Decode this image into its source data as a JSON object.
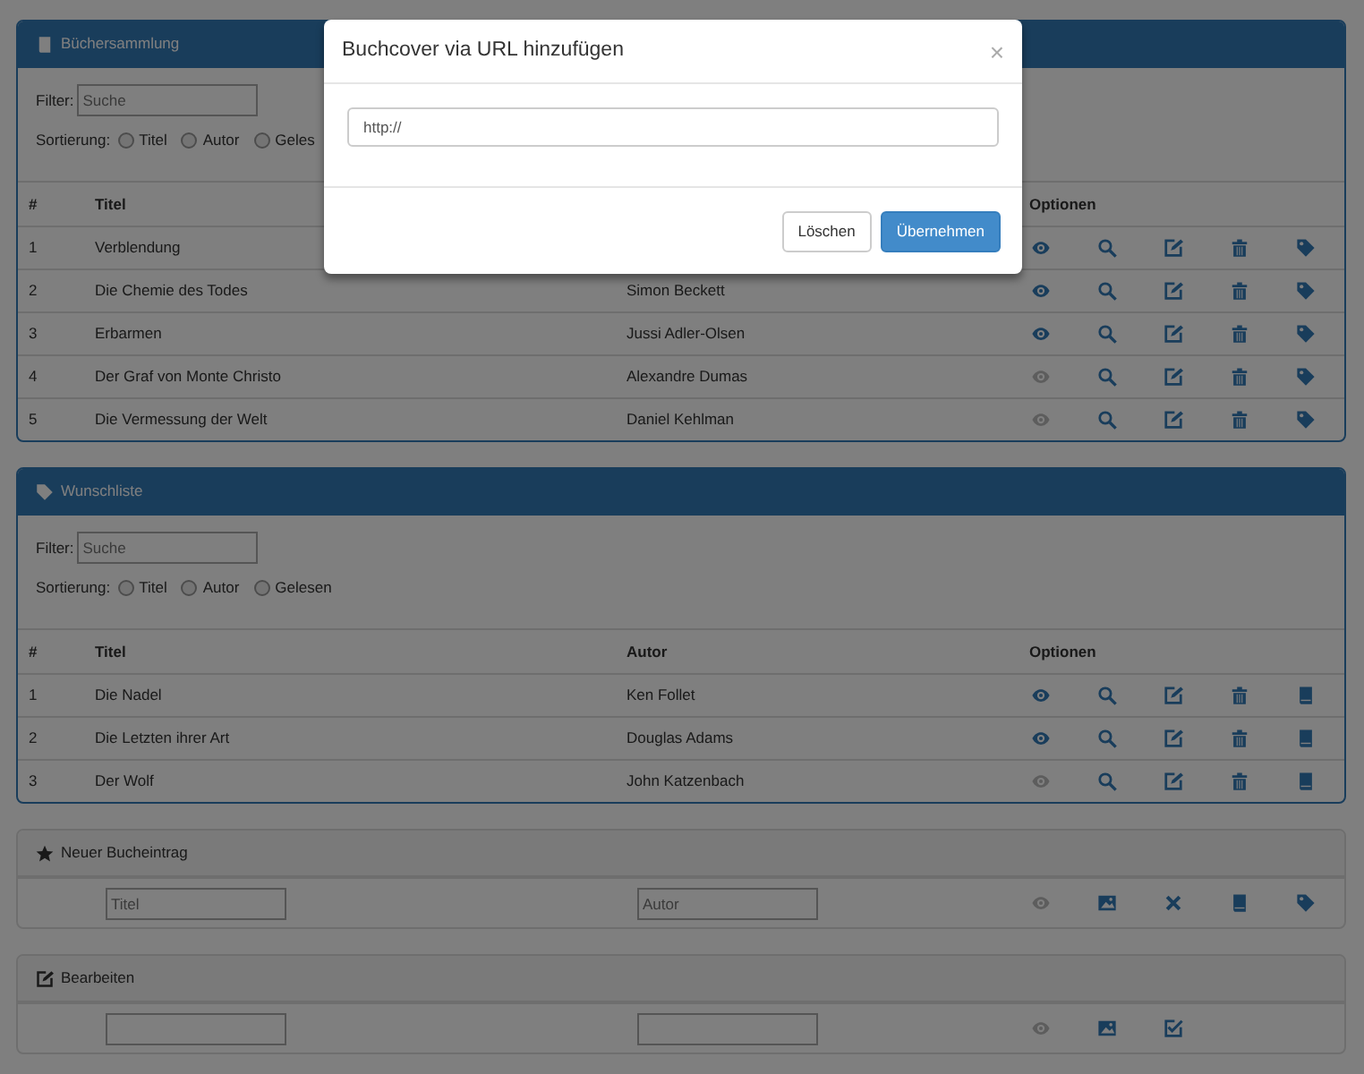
{
  "panels": [
    {
      "kind": "collection",
      "title": "Büchersammlung",
      "filter": {
        "label": "Filter:",
        "placeholder": "Suche"
      },
      "sort": {
        "label": "Sortierung:",
        "options": [
          {
            "label": "Titel",
            "selected": false
          },
          {
            "label": "Autor",
            "selected": false
          },
          {
            "label": "Geles",
            "selected": false
          }
        ]
      },
      "columns": [
        {
          "label": "#"
        },
        {
          "label": "Titel"
        },
        {},
        {
          "label": "Optionen"
        }
      ],
      "actions": [
        {
          "kind": "view"
        },
        {
          "kind": "search"
        },
        {
          "kind": "edit"
        },
        {
          "kind": "delete"
        },
        {
          "kind": "tag"
        }
      ],
      "rows": [
        {
          "number": "1",
          "title": "Verblendung",
          "read": true
        },
        {
          "number": "2",
          "title": "Die Chemie des Todes",
          "author": "Simon Beckett",
          "read": true
        },
        {
          "number": "3",
          "title": "Erbarmen",
          "author": "Jussi Adler-Olsen",
          "read": true
        },
        {
          "number": "4",
          "title": "Der Graf von Monte Christo",
          "author": "Alexandre Dumas",
          "read": false
        },
        {
          "number": "5",
          "title": "Die Vermessung der Welt",
          "author": "Daniel Kehlman",
          "read": false
        }
      ]
    },
    {
      "kind": "wishlist",
      "title": "Wunschliste",
      "filter": {
        "label": "Filter:",
        "placeholder": "Suche"
      },
      "sort": {
        "label": "Sortierung:",
        "options": [
          {
            "label": "Titel",
            "selected": false
          },
          {
            "label": "Autor",
            "selected": false
          },
          {
            "label": "Gelesen",
            "selected": false
          }
        ]
      },
      "columns": [
        {
          "label": "#"
        },
        {
          "label": "Titel"
        },
        {
          "label": "Autor"
        },
        {
          "label": "Optionen"
        }
      ],
      "actions": [
        {
          "kind": "view"
        },
        {
          "kind": "search"
        },
        {
          "kind": "edit"
        },
        {
          "kind": "delete"
        },
        {
          "kind": "book"
        }
      ],
      "rows": [
        {
          "number": "1",
          "title": "Die Nadel",
          "author": "Ken Follet",
          "read": true
        },
        {
          "number": "2",
          "title": "Die Letzten ihrer Art",
          "author": "Douglas Adams",
          "read": true
        },
        {
          "number": "3",
          "title": "Der Wolf",
          "author": "John Katzenbach",
          "read": false
        }
      ]
    },
    {
      "kind": "new_entry",
      "title": "Neuer Bucheintrag",
      "title_field": {
        "placeholder": "Titel"
      },
      "author_field": {
        "placeholder": "Autor"
      },
      "read": false,
      "actions": [
        {
          "kind": "image"
        },
        {
          "kind": "cancel"
        },
        {
          "kind": "book"
        },
        {
          "kind": "tag"
        }
      ]
    },
    {
      "kind": "edit",
      "title": "Bearbeiten",
      "read": false,
      "actions": [
        {
          "kind": "image"
        },
        {
          "kind": "confirm"
        }
      ]
    }
  ],
  "dialog": {
    "title": "Buchcover via URL hinzufügen",
    "close": "×",
    "url_field": {
      "value": "http://"
    },
    "buttons": [
      {
        "label": "Löschen",
        "kind": "secondary"
      },
      {
        "label": "Übernehmen",
        "kind": "primary"
      }
    ]
  }
}
